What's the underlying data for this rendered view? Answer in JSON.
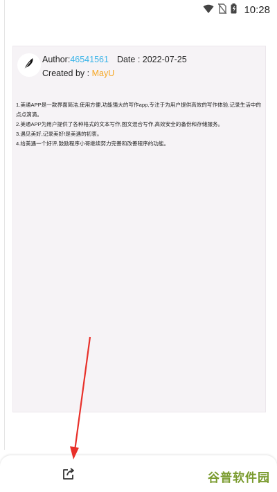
{
  "status_bar": {
    "time": "10:28",
    "icons": [
      "wifi-icon",
      "no-sim-icon",
      "battery-icon"
    ]
  },
  "document": {
    "author_label": "Author:",
    "author_id": "46541561",
    "date_label": "Date : ",
    "date": "2022-07-25",
    "created_by_label": "Created by : ",
    "created_by": "MayU",
    "paragraphs": [
      "1.美通APP是一款界面简洁,使用方便,功能强大的写作app,专注于为用户提供高效的写作体验,记录生活中的点点滴滴。",
      "2.美通APP为用户提供了各种格式的文本写作,图文混合写作,高效安全的备份和存储服务。",
      "3.遇见美好,记录美好!是美遇的初衷。",
      "4.给美遇一个好评,鼓励程序小哥继续努力完善和改善程序的功能。"
    ]
  },
  "bottom_bar": {
    "share_icon": "share-icon",
    "watermark": "谷普软件园"
  },
  "colors": {
    "author_id": "#3bb4e8",
    "created_by": "#f5a623",
    "arrow": "#e8302a",
    "watermark": "#7a9b2e"
  }
}
